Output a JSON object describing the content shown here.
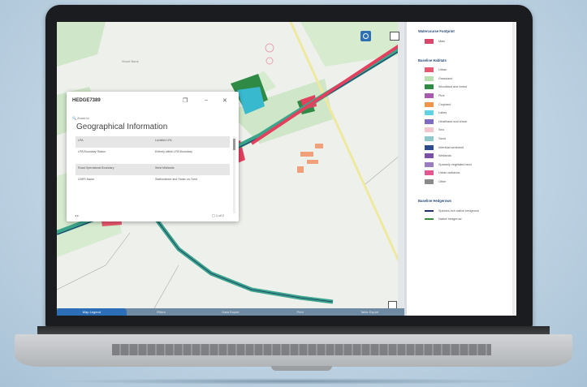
{
  "popup": {
    "title": "HEDGE7389",
    "zoom_label": "Zoom to",
    "section_title": "Geographical Information",
    "rows": [
      {
        "key": "LPA",
        "value": "Lichfield LPA"
      },
      {
        "key": "LPA Boundary Status",
        "value": "Entirely within LPA Boundary"
      },
      {
        "key": "Road Operational Boundary",
        "value": "West Midlands"
      },
      {
        "key": "LNRS Name",
        "value": "Staffordshire and Stoke-on-Trent"
      }
    ],
    "count": "1 of 2"
  },
  "legend": {
    "groups": [
      {
        "title": "Watercourse Footprint",
        "items": [
          {
            "label": "Main",
            "color": "#d9476a",
            "kind": "fill"
          }
        ]
      },
      {
        "title": "Baseline Habitats",
        "items": [
          {
            "label": "Urban",
            "color": "#e8576f",
            "kind": "fill"
          },
          {
            "label": "Grassland",
            "color": "#b9dfb0",
            "kind": "fill"
          },
          {
            "label": "Woodland and forest",
            "color": "#2f8a45",
            "kind": "fill"
          },
          {
            "label": "Pine",
            "color": "#a85ab0",
            "kind": "fill"
          },
          {
            "label": "Cropland",
            "color": "#f0944c",
            "kind": "fill"
          },
          {
            "label": "Lakes",
            "color": "#5fd3e3",
            "kind": "fill"
          },
          {
            "label": "Heathland and shrub",
            "color": "#7d6cc2",
            "kind": "fill"
          },
          {
            "label": "Sea",
            "color": "#f3c6d0",
            "kind": "fill"
          },
          {
            "label": "Sand",
            "color": "#8fc9cc",
            "kind": "fill"
          },
          {
            "label": "Intertidal sediment",
            "color": "#2c4b8f",
            "kind": "fill"
          },
          {
            "label": "Wetlands",
            "color": "#7a4fa8",
            "kind": "fill"
          },
          {
            "label": "Sparsely vegetated land",
            "color": "#9a7cc0",
            "kind": "fill"
          },
          {
            "label": "Urban wetlands",
            "color": "#e3568f",
            "kind": "fill"
          },
          {
            "label": "Other",
            "color": "#8a8a8a",
            "kind": "fill"
          }
        ]
      },
      {
        "title": "Baseline Hedgerows",
        "items": [
          {
            "label": "Species-rich native hedgerow",
            "color": "#1f2f6b",
            "kind": "line"
          },
          {
            "label": "Native hedgerow",
            "color": "#3b8a3b",
            "kind": "line"
          }
        ]
      }
    ]
  },
  "tabs": [
    "Map Legend",
    "Filters",
    "Data Export",
    "Print",
    "Table Export"
  ],
  "map": {
    "place_label": "Wood Bank"
  }
}
